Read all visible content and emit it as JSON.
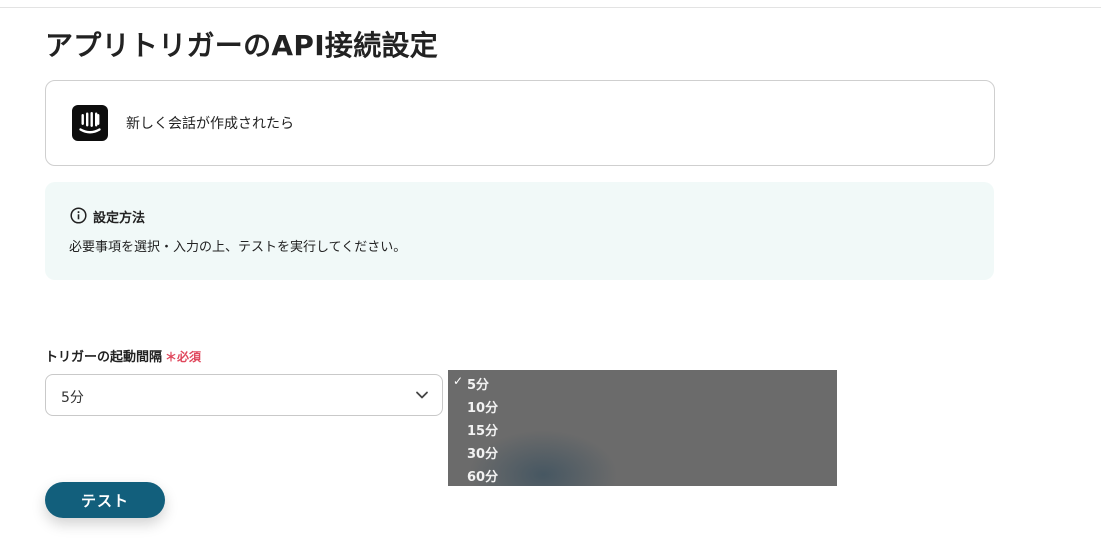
{
  "page": {
    "title": "アプリトリガーのAPI接続設定"
  },
  "app_card": {
    "icon": "intercom-logo",
    "label": "新しく会話が作成されたら"
  },
  "info": {
    "icon": "info-circle-icon",
    "title": "設定方法",
    "text": "必要事項を選択・入力の上、テストを実行してください。",
    "background": "#f1f9f8"
  },
  "trigger_interval": {
    "label": "トリガーの起動間隔",
    "required_mark": "＊",
    "required_text": "必須",
    "selected_value": "5分",
    "chevron_icon": "chevron-down-icon",
    "options": [
      {
        "label": "5分",
        "checked": true
      },
      {
        "label": "10分",
        "checked": false
      },
      {
        "label": "15分",
        "checked": false
      },
      {
        "label": "30分",
        "checked": false
      },
      {
        "label": "60分",
        "checked": false
      }
    ],
    "check_glyph": "✓"
  },
  "actions": {
    "test_label": "テスト",
    "test_color": "#125f7c"
  },
  "colors": {
    "required": "#e0475c",
    "dropdown_bg": "#6b6b6b"
  }
}
